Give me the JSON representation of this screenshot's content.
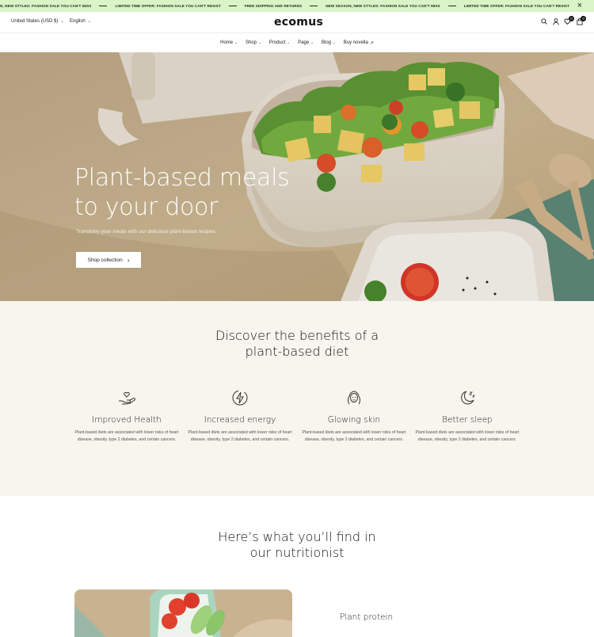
{
  "announcement": {
    "messages": [
      "N, NEW STYLES: FASHION SALE YOU CAN'T MISS",
      "LIMITED TIME OFFER: FASHION SALE YOU CAN'T RESIST",
      "FREE SHIPPING AND RETURNS",
      "NEW SEASON, NEW STYLES: FASHION SALE YOU CAN'T MISS",
      "LIMITED TIME OFFER: FASHION SALE YOU CAN'T RESIST"
    ],
    "close_icon": "close-icon"
  },
  "header": {
    "currency": "United States (USD $)",
    "language": "English",
    "logo": "ecomus",
    "icons": [
      "search-icon",
      "user-icon",
      "heart-icon",
      "cart-icon"
    ],
    "wishlist_count": "0",
    "cart_count": "0"
  },
  "nav": {
    "items": [
      {
        "label": "Home",
        "dropdown": true
      },
      {
        "label": "Shop",
        "dropdown": true
      },
      {
        "label": "Product",
        "dropdown": true
      },
      {
        "label": "Page",
        "dropdown": true
      },
      {
        "label": "Blog",
        "dropdown": true
      },
      {
        "label": "Buy novella",
        "dropdown": false
      }
    ]
  },
  "hero": {
    "title_line1": "Plant-based meals",
    "title_line2": "to your door",
    "subtitle": "Transform your meals with our delicious plant-based recipes",
    "button_label": "Shop collection",
    "slide_count": 3,
    "active_slide": 1
  },
  "benefits": {
    "title_line1": "Discover the benefits of a",
    "title_line2": "plant-based diet",
    "items": [
      {
        "icon": "heart-hand-icon",
        "title": "Improved Health",
        "text": "Plant-based diets are associated with lower risks of heart disease, obesity, type 2 diabetes, and certain cancers."
      },
      {
        "icon": "energy-icon",
        "title": "Increased energy",
        "text": "Plant-based diets are associated with lower risks of heart disease, obesity, type 2 diabetes, and certain cancers."
      },
      {
        "icon": "face-icon",
        "title": "Glowing skin",
        "text": "Plant-based diets are associated with lower risks of heart disease, obesity, type 2 diabetes, and certain cancers."
      },
      {
        "icon": "moon-icon",
        "title": "Better sleep",
        "text": "Plant-based diets are associated with lower risks of heart disease, obesity, type 2 diabetes, and certain cancers."
      }
    ]
  },
  "nutritionist": {
    "title_line1": "Here’s what you’ll find in",
    "title_line2": "our nutritionist",
    "first_item": "Plant protein"
  },
  "colors": {
    "announcement_bg": "#d9f4c7",
    "benefits_bg": "#f8f4ee",
    "text": "#222222"
  }
}
